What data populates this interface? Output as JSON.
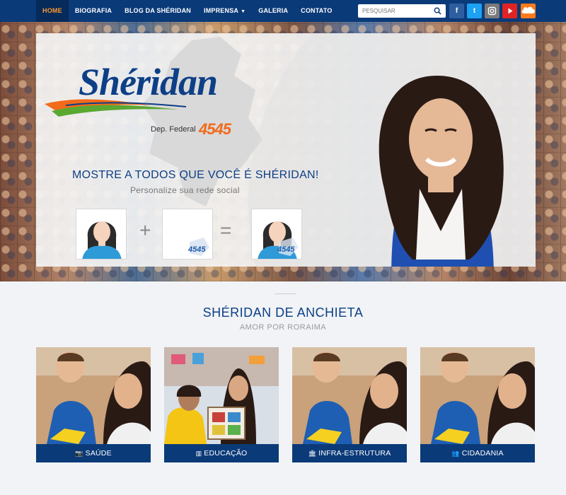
{
  "nav": {
    "items": [
      {
        "label": "HOME",
        "active": true
      },
      {
        "label": "BIOGRAFIA"
      },
      {
        "label": "BLOG DA SHÉRIDAN"
      },
      {
        "label": "IMPRENSA",
        "caret": true
      },
      {
        "label": "GALERIA"
      },
      {
        "label": "CONTATO"
      }
    ],
    "search_placeholder": "PESQUISAR",
    "social": [
      {
        "name": "facebook-icon",
        "glyph": "f",
        "color": "#2d5fa0"
      },
      {
        "name": "twitter-icon",
        "glyph": "t",
        "color": "#1da1f2"
      },
      {
        "name": "instagram-icon",
        "glyph": "◘",
        "color": "#7a7a7a"
      },
      {
        "name": "youtube-icon",
        "glyph": "▶",
        "color": "#e02424"
      },
      {
        "name": "soundcloud-icon",
        "glyph": "☁",
        "color": "#ff7a1a"
      }
    ]
  },
  "hero": {
    "logo_name": "Shéridan",
    "logo_dep": "Dep. Federal",
    "logo_number": "4545",
    "cta_title": "MOSTRE A TODOS QUE VOCÊ É SHÉRIDAN!",
    "cta_subtitle": "Personalize sua rede social",
    "op_plus": "+",
    "op_equals": "=",
    "badge_text": "4545"
  },
  "section": {
    "title": "SHÉRIDAN DE ANCHIETA",
    "subtitle": "AMOR POR RORAIMA"
  },
  "cards": [
    {
      "label": "SAÚDE",
      "icon": "camera-icon"
    },
    {
      "label": "EDUCAÇÃO",
      "icon": "book-icon"
    },
    {
      "label": "INFRA-ESTRUTURA",
      "icon": "building-icon"
    },
    {
      "label": "CIDADANIA",
      "icon": "users-icon"
    }
  ],
  "colors": {
    "navbar": "#0b3a78",
    "active_text": "#ff9a2e",
    "brand_blue": "#0d3f86",
    "brand_orange": "#f26a1b"
  }
}
